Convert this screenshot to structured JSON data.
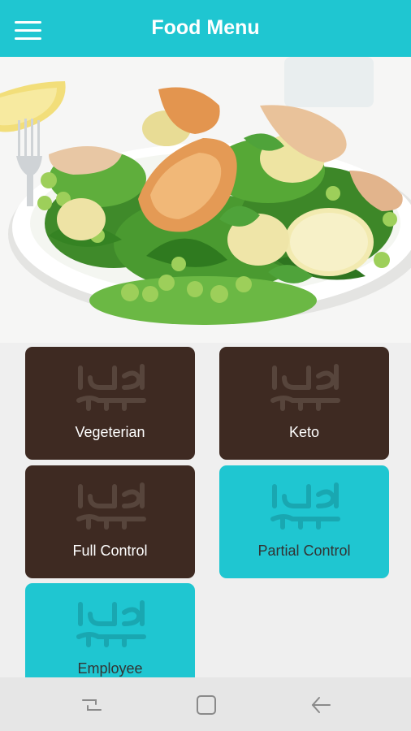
{
  "app_bar": {
    "title": "Food Menu",
    "menu_icon": "hamburger-menu-icon",
    "color": "#1fc6d1"
  },
  "hero": {
    "image": "salad-plate-photo"
  },
  "categories": [
    {
      "label": "Vegeterian",
      "style": "dark"
    },
    {
      "label": "Keto",
      "style": "dark"
    },
    {
      "label": "Full Control",
      "style": "dark"
    },
    {
      "label": "Partial Control",
      "style": "teal"
    },
    {
      "label": "Employee",
      "style": "teal"
    }
  ],
  "colors": {
    "teal": "#1fc6d1",
    "dark_brown": "#3e2a22"
  },
  "nav_bar": {
    "icons": [
      "recent-apps-icon",
      "home-icon",
      "back-icon"
    ]
  }
}
